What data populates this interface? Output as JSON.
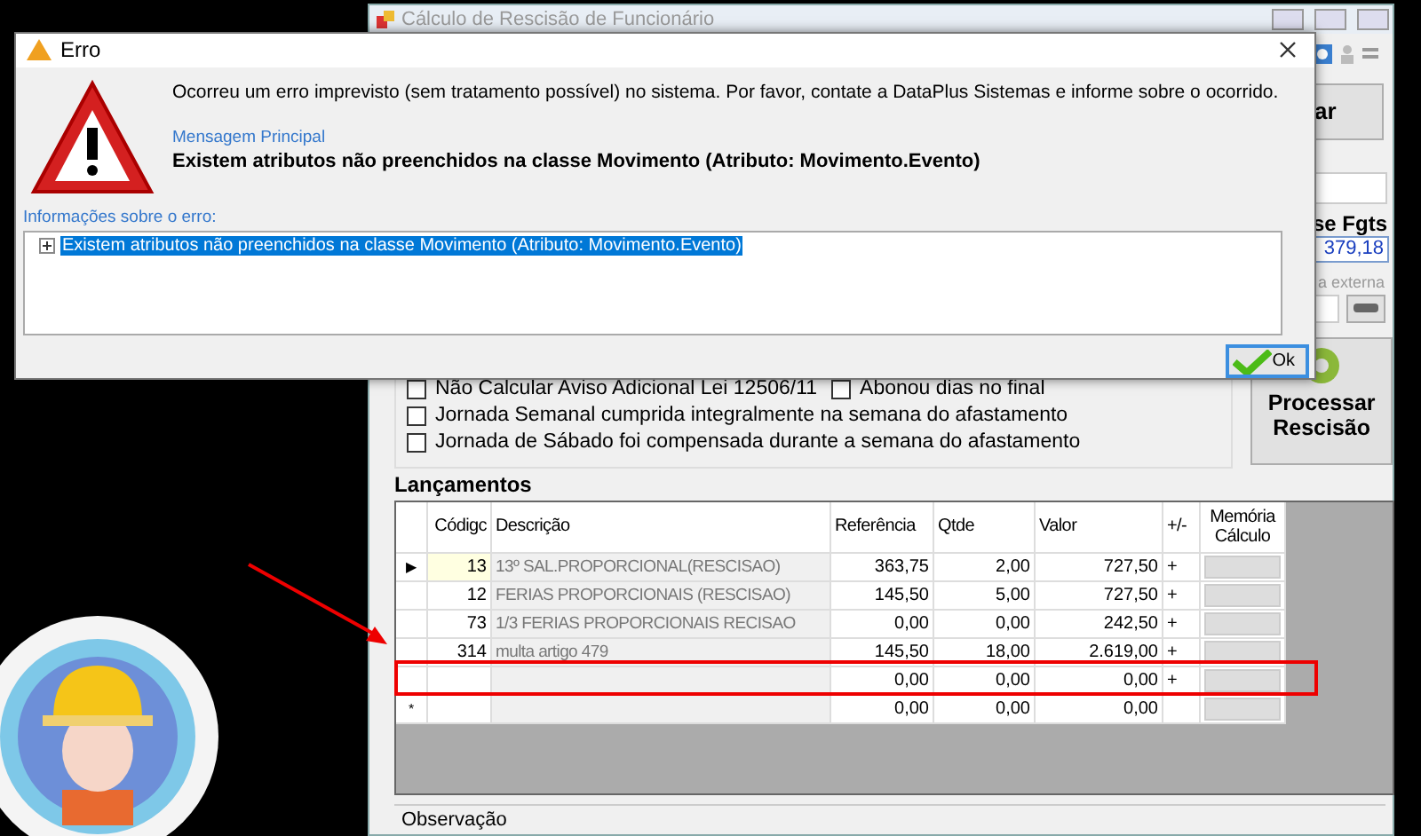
{
  "background_window": {
    "title": "Cálculo de Rescisão de Funcionário",
    "right_panel": {
      "button": "ar",
      "base_label": "se Fgts",
      "base_value": "379,18",
      "external_label": "a externa"
    },
    "option_rows": [
      {
        "options": [
          {
            "label": "Não Calcular Aviso Adicional Lei 12506/11",
            "checked": false
          },
          {
            "label": "Abonou dias no final",
            "checked": false
          }
        ]
      },
      {
        "options": [
          {
            "label": "Jornada Semanal cumprida integralmente na semana do afastamento",
            "checked": false
          }
        ]
      },
      {
        "options": [
          {
            "label": "Jornada de Sábado foi compensada durante a semana do afastamento",
            "checked": false
          }
        ]
      }
    ],
    "process_button": "Processar Rescisão",
    "entries": {
      "title": "Lançamentos",
      "columns": [
        "Códigc",
        "Descrição",
        "Referência",
        "Qtde",
        "Valor",
        "+/-",
        "Memória Cálculo"
      ],
      "rows": [
        {
          "marker": "▶",
          "code": "13",
          "description": "13º SAL.PROPORCIONAL(RESCISAO)",
          "reference": "363,75",
          "quantity": "2,00",
          "value": "727,50",
          "sign": "+",
          "current": true
        },
        {
          "code": "12",
          "description": "FERIAS PROPORCIONAIS (RESCISAO)",
          "reference": "145,50",
          "quantity": "5,00",
          "value": "727,50",
          "sign": "+",
          "current": false
        },
        {
          "code": "73",
          "description": "1/3 FERIAS PROPORCIONAIS RECISAO",
          "reference": "0,00",
          "quantity": "0,00",
          "value": "242,50",
          "sign": "+",
          "current": false
        },
        {
          "code": "314",
          "description": "multa artigo 479",
          "reference": "145,50",
          "quantity": "18,00",
          "value": "2.619,00",
          "sign": "+",
          "current": false
        },
        {
          "reference": "0,00",
          "quantity": "0,00",
          "value": "0,00",
          "sign": "+",
          "current": false,
          "annotated": true
        },
        {
          "marker": "*",
          "reference": "0,00",
          "quantity": "0,00",
          "value": "0,00",
          "current": false
        }
      ]
    },
    "observation_label": "Observação"
  },
  "dialog": {
    "title": "Erro",
    "message": "Ocorreu um erro imprevisto (sem tratamento possível) no sistema. Por favor, contate a DataPlus Sistemas e informe sobre o ocorrido.",
    "main_label": "Mensagem Principal",
    "main_message": "Existem atributos não preenchidos na classe Movimento (Atributo: Movimento.Evento)",
    "details_label": "Informações sobre o erro:",
    "details": [
      {
        "text": "Existem atributos não preenchidos na classe Movimento (Atributo: Movimento.Evento)",
        "selected": true,
        "expanded": false
      }
    ],
    "ok_button": "Ok"
  }
}
